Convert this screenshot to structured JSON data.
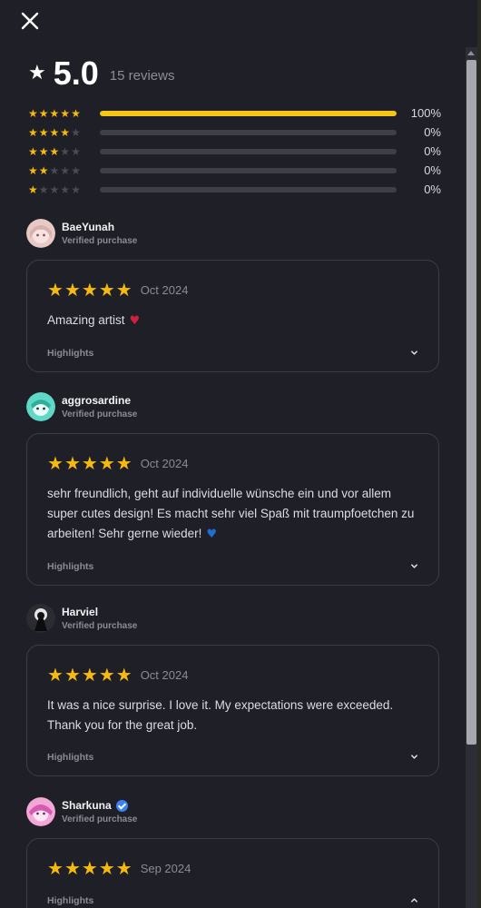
{
  "summary": {
    "avg_star": "★",
    "average": "5.0",
    "review_count": "15 reviews"
  },
  "distribution": [
    {
      "stars": 5,
      "fraction": 1.0,
      "percent": "100%"
    },
    {
      "stars": 4,
      "fraction": 0.0,
      "percent": "0%"
    },
    {
      "stars": 3,
      "fraction": 0.0,
      "percent": "0%"
    },
    {
      "stars": 2,
      "fraction": 0.0,
      "percent": "0%"
    },
    {
      "stars": 1,
      "fraction": 0.0,
      "percent": "0%"
    }
  ],
  "reviews": [
    {
      "name": "BaeYunah",
      "sub": "Verified purchase",
      "rating": 5,
      "date": "Oct 2024",
      "text": "Amazing artist",
      "emoji": "♥",
      "emoji_color": "#d0213c",
      "highlights": "Highlights",
      "expanded": false
    },
    {
      "name": "aggrosardine",
      "sub": "Verified purchase",
      "rating": 5,
      "date": "Oct 2024",
      "text": "sehr freundlich, geht auf individuelle wünsche ein und vor allem super cutes design! Es macht sehr viel Spaß mit traumpfoetchen zu arbeiten! Sehr gerne wieder!",
      "emoji": "♥",
      "emoji_color": "#1f6fd1",
      "highlights": "Highlights",
      "expanded": false
    },
    {
      "name": "Harviel",
      "sub": "Verified purchase",
      "rating": 5,
      "date": "Oct 2024",
      "text": "It was a nice surprise. I love it. My expectations were exceeded. Thank you for the great job.",
      "emoji": "",
      "highlights": "Highlights",
      "expanded": false
    },
    {
      "name": "Sharkuna",
      "sub": "Verified purchase",
      "rating": 5,
      "date": "Sep 2024",
      "text": "",
      "emoji": "",
      "highlights": "Highlights",
      "verified_badge": true,
      "expanded": true
    }
  ],
  "colors": {
    "background": "#1f2027",
    "star": "#f5b90f",
    "bar_fill": "#f5c518",
    "verified": "#3b82f6"
  },
  "icons": {
    "close": "close-icon",
    "star": "star-icon",
    "chevron": "chevron-icon"
  }
}
